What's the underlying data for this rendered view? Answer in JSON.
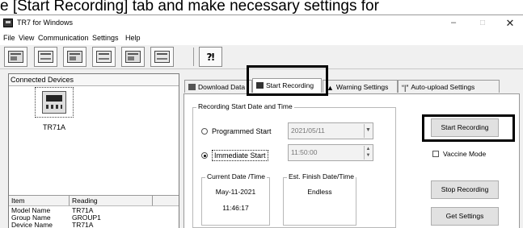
{
  "caption": "e [Start Recording] tab and make necessary settings for",
  "window": {
    "title": "TR7 for Windows",
    "controls": {
      "minimize": "–",
      "maximize": "□",
      "close": "✕"
    }
  },
  "menu": {
    "file": "File",
    "view": "View",
    "communication": "Communication",
    "settings": "Settings",
    "help": "Help"
  },
  "toolbar": {
    "help_glyph": "⁈"
  },
  "left_panel": {
    "title": "Connected Devices",
    "device_label": "TR71A",
    "grid": {
      "headers": [
        "Item",
        "Reading"
      ],
      "rows": [
        {
          "item": "Model Name",
          "reading": "TR71A"
        },
        {
          "item": "Group Name",
          "reading": "GROUP1"
        },
        {
          "item": "Device Name",
          "reading": "TR71A"
        }
      ]
    }
  },
  "tabs": {
    "download": "Download Data",
    "start_recording": "Start Recording",
    "warning": "Warning Settings",
    "auto_upload": "Auto-upload Settings"
  },
  "recording": {
    "group_title": "Recording Start Date and Time",
    "programmed_label": "Programmed Start",
    "programmed_date": "2021/05/11",
    "immediate_label": "Immediate Start",
    "immediate_time": "11:50:00",
    "selected": "immediate",
    "current_title": "Current Date /Time",
    "current_date": "May-11-2021",
    "current_time": "11:46:17",
    "finish_title": "Est. Finish Date/Time",
    "finish_value": "Endless"
  },
  "buttons": {
    "start_recording": "Start Recording",
    "stop_recording": "Stop Recording",
    "get_settings": "Get Settings"
  },
  "vaccine_mode": {
    "label": "Vaccine Mode",
    "checked": false
  },
  "colors": {
    "window_bg": "#f0f0f0",
    "panel_bg": "#ffffff",
    "highlight": "#000000"
  }
}
